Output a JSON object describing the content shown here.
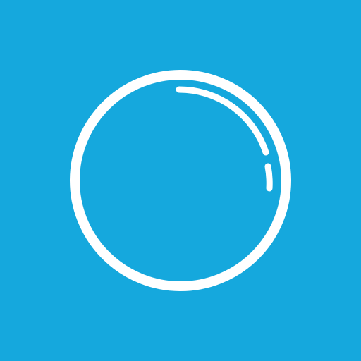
{
  "icon": {
    "name": "bubble-icon",
    "background_color": "#15A8DD",
    "stroke_color": "#FFFFFF"
  }
}
